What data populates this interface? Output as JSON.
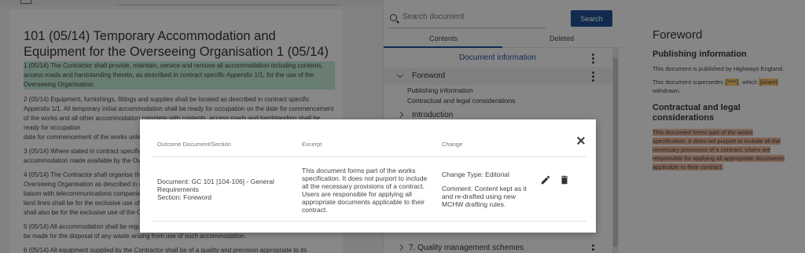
{
  "document": {
    "title": "101 (05/14) Temporary Accommodation and Equipment for the Overseeing Organisation 1 (05/14)",
    "paragraphs": [
      "1 (05/14) The Contractor shall provide, maintain, service and remove all accommodation including contents, access roads and hardstanding thereto, as described in contract specific Appendix 1/1, for the use of the Overseeing Organisation.",
      "2 (05/14) Equipment, furnishings, fittings and supplies shall be located as described in contract specific Appendix 1/1. All temporary initial accommodation shall be ready for occupation on the date for commencement of the works and all other accommodation complete with contents, access roads and hardstanding shall be ready for occupation",
      "date for commencement of the works unless",
      "3 (05/14) Where stated in contract specific",
      "accommodation made available by the Ove",
      "4 (05/14) The Contractor shall organise the",
      "Overseeing Organisation as described in c",
      "liaison with telecommunications companies",
      "land lines shall be for the exclusive use of",
      "shall also be for the exclusive use of the O",
      "5 (05/14) All accommodation shall be regul",
      "be made for the disposal of any waste arising from use of such accommodation.",
      "6 (05/14) All equipment supplied by the Contractor shall be of a quality and precision appropriate to its"
    ]
  },
  "search": {
    "placeholder": "Search document",
    "button": "Search"
  },
  "tabs": {
    "contents": "Contents",
    "deleted": "Deleted"
  },
  "toc": {
    "document_information": "Document information",
    "foreword": "Foreword",
    "foreword_children": [
      "Publishing information",
      "Contractual and legal considerations"
    ],
    "introduction": "Introduction",
    "last_item": "7. Quality management schemes"
  },
  "preview": {
    "heading": "Foreword",
    "publishing_heading": "Publishing information",
    "publishing_text": "This document is published by Highways England.",
    "supersedes_pre": "This document supersedes ",
    "supersedes_ref": "[****]",
    "supersedes_mid": ", which ",
    "supersedes_isare": "[is/are]",
    "withdrawn": "withdrawn.",
    "contractual_heading": "Contractual and legal considerations",
    "contractual_text": "This document forms part of the works specification. It does not purport to include all the necessary provisions of a contract. Users are responsible for applying all appropriate documents applicable to their contract."
  },
  "modal": {
    "headers": [
      "Outcome Document/Section",
      "Excerpt",
      "Change"
    ],
    "row": {
      "document": "Document: GC 101 [104-106] - General Requirements",
      "section": "Section: Foreword",
      "excerpt": "This document forms part of the works specification. It does not purport to include all the necessary provisions of a contract. Users are responsible for applying all appropriate documents applicable to their contract.",
      "change_type": "Change Type: Editorial",
      "comment": "Comment: Content kept as it and re-drafted using new MCHW drafting rules."
    },
    "icons": [
      "edit-icon",
      "delete-icon",
      "close-icon"
    ]
  },
  "colors": {
    "primary": "#1e4f8f",
    "highlight_green": "#bfe6cf",
    "highlight_orange": "#e8b59a",
    "highlight_yellow": "#f3c36a"
  }
}
